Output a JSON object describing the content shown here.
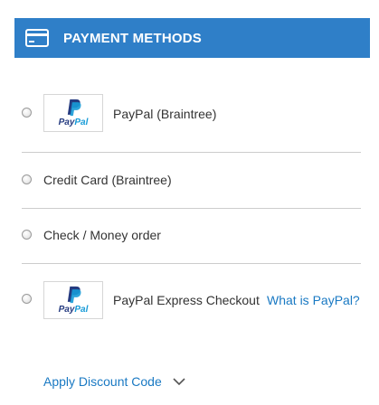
{
  "header": {
    "title": "PAYMENT METHODS",
    "icon": "credit-card-icon"
  },
  "methods": [
    {
      "label": "PayPal (Braintree)",
      "logo": {
        "pay": "Pay",
        "pal": "Pal"
      },
      "selected": false
    },
    {
      "label": "Credit Card (Braintree)",
      "selected": false
    },
    {
      "label": "Check / Money order",
      "selected": false
    },
    {
      "label": "PayPal Express Checkout",
      "link": "What is PayPal?",
      "logo": {
        "pay": "Pay",
        "pal": "Pal"
      },
      "selected": false
    }
  ],
  "discount": {
    "label": "Apply Discount Code",
    "icon": "chevron-down-icon"
  },
  "colors": {
    "header_bg": "#2f7fc8",
    "link": "#1979c3",
    "divider": "#cccccc"
  }
}
